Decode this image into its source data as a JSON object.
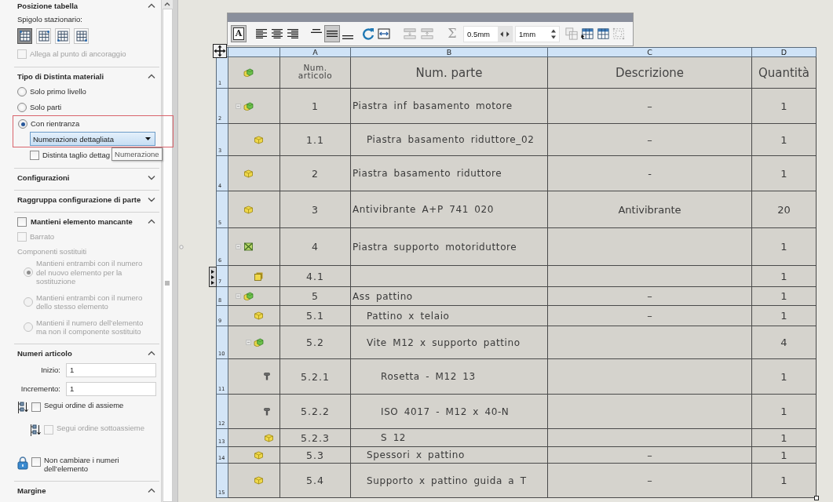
{
  "property_panel": {
    "sections": [
      {
        "title": "Posizione tabella",
        "expanded": true,
        "items": [
          {
            "kind": "label",
            "text": "Spigolo stazionario:",
            "disabled": false
          },
          {
            "kind": "anchor_buttons",
            "options": [
              {
                "selected": true
              },
              {
                "selected": false
              },
              {
                "selected": false
              },
              {
                "selected": false
              }
            ]
          },
          {
            "kind": "checkbox",
            "label": "Allega al punto di ancoraggio",
            "checked": false,
            "disabled": true
          }
        ]
      },
      {
        "title": "Tipo di Distinta materiali",
        "expanded": true,
        "items": [
          {
            "kind": "radio",
            "label": "Solo primo livello",
            "selected": false,
            "disabled": false
          },
          {
            "kind": "radio",
            "label": "Solo parti",
            "selected": false,
            "disabled": false
          },
          {
            "kind": "radio",
            "label": "Con rientranza",
            "selected": true,
            "disabled": false,
            "highlighted": true,
            "dropdown": {
              "value": "Numerazione dettagliata"
            },
            "children": [
              {
                "kind": "checkbox",
                "label": "Distinta taglio dettag",
                "checked": false,
                "disabled": false,
                "tooltip": "Numerazione"
              }
            ]
          }
        ]
      },
      {
        "title": "Configurazioni",
        "expanded": false
      },
      {
        "title": "Raggruppa configurazione di parte",
        "expanded": false
      },
      {
        "title": "Mantieni elemento mancante",
        "expanded": true,
        "checkbox": {
          "checked": false
        },
        "items": [
          {
            "kind": "checkbox",
            "label": "Barrato",
            "checked": false,
            "disabled": true
          },
          {
            "kind": "label",
            "text": "Componenti sostituiti",
            "disabled": true,
            "children": [
              {
                "kind": "radio",
                "label": "Mantieni entrambi con il numero del nuovo elemento per la sostituzione",
                "selected": true,
                "disabled": true
              },
              {
                "kind": "radio",
                "label": "Mantieni entrambi con il numero dello stesso elemento",
                "selected": false,
                "disabled": true
              },
              {
                "kind": "radio",
                "label": "Mantieni il numero dell’elemento ma non il componente sostituito",
                "selected": false,
                "disabled": true
              }
            ]
          }
        ]
      },
      {
        "title": "Numeri articolo",
        "expanded": true,
        "items": [
          {
            "kind": "field",
            "label": "Inizio:",
            "value": "1",
            "disabled": false
          },
          {
            "kind": "field",
            "label": "Incremento:",
            "value": "1",
            "disabled": false
          },
          {
            "kind": "tree_checkbox",
            "label": "Segui ordine di assieme",
            "checked": false,
            "disabled": false,
            "children": [
              {
                "kind": "tree_checkbox",
                "label": "Segui ordine sottoassieme",
                "checked": false,
                "disabled": true
              }
            ]
          },
          {
            "kind": "lock_checkbox",
            "label": "Non cambiare i numeri dell’elemento",
            "checked": false,
            "disabled": false
          }
        ]
      },
      {
        "title": "Margine",
        "expanded": true
      }
    ]
  },
  "format_toolbar": {
    "groups": [
      {
        "tools": [
          {
            "kind": "text-format",
            "glyph": "A",
            "on": true,
            "disabled": false
          }
        ]
      },
      {
        "tools": [
          {
            "kind": "align-left",
            "on": false,
            "disabled": false
          },
          {
            "kind": "align-center",
            "on": false,
            "disabled": false
          },
          {
            "kind": "align-right",
            "on": false,
            "disabled": false
          }
        ]
      },
      {
        "tools": [
          {
            "kind": "align-top",
            "on": false,
            "disabled": false
          },
          {
            "kind": "align-middle",
            "on": true,
            "disabled": false
          },
          {
            "kind": "align-bottom",
            "on": false,
            "disabled": false
          }
        ]
      },
      {
        "tools": [
          {
            "kind": "rotate",
            "on": false,
            "disabled": false
          },
          {
            "kind": "fit-width",
            "on": false,
            "disabled": false
          }
        ]
      },
      {
        "tools": [
          {
            "kind": "insert-below",
            "on": false,
            "disabled": true
          },
          {
            "kind": "insert-above",
            "on": false,
            "disabled": true
          }
        ]
      },
      {
        "tools": [
          {
            "kind": "sum",
            "glyph": "Σ",
            "on": false,
            "disabled": true
          },
          {
            "kind": "spin-horizontal",
            "value": "0.5mm"
          },
          {
            "kind": "spin-vertical",
            "value": "1mm"
          }
        ]
      },
      {
        "tools": [
          {
            "kind": "copy-format",
            "on": false,
            "disabled": true
          },
          {
            "kind": "table-properties",
            "on": false,
            "disabled": false
          },
          {
            "kind": "table-grid",
            "on": false,
            "disabled": false
          },
          {
            "kind": "borders",
            "on": false,
            "disabled": true
          }
        ]
      }
    ]
  },
  "bom_table": {
    "column_letters": [
      "A",
      "B",
      "C",
      "D"
    ],
    "header_row": {
      "row_label": "1",
      "cells": [
        "Num. articolo",
        "Num. parte",
        "Descrizione",
        "Quantità"
      ]
    },
    "rows": [
      {
        "row_label": "2",
        "kind": "assembly",
        "expanded": true,
        "item": "1",
        "part": "Piastra inf basamento motore",
        "description": "–",
        "quantity": "1",
        "children": [
          {
            "row_label": "3",
            "kind": "part",
            "expanded": false,
            "item": "1.1",
            "part": "Piastra basamento riduttore_02",
            "description": "–",
            "quantity": "1"
          }
        ]
      },
      {
        "row_label": "4",
        "kind": "part",
        "expanded": false,
        "item": "2",
        "part": "Piastra basamento riduttore",
        "description": "-",
        "quantity": "1"
      },
      {
        "row_label": "5",
        "kind": "part",
        "expanded": false,
        "item": "3",
        "part": "Antivibrante A+P 741 020",
        "description": "Antivibrante",
        "quantity": "20"
      },
      {
        "row_label": "6",
        "kind": "weldment",
        "expanded": true,
        "item": "4",
        "part": "Piastra supporto motoriduttore",
        "quantity": "1",
        "children": [
          {
            "row_label": "7",
            "kind": "body",
            "expanded": false,
            "item": "4.1",
            "quantity": "1"
          }
        ]
      },
      {
        "row_label": "8",
        "kind": "assembly",
        "expanded": true,
        "item": "5",
        "part": "Ass pattino",
        "description": "–",
        "quantity": "1",
        "children": [
          {
            "row_label": "9",
            "kind": "part",
            "expanded": false,
            "item": "5.1",
            "part": "Pattino x telaio",
            "description": "–",
            "quantity": "1"
          },
          {
            "row_label": "10",
            "kind": "assembly",
            "expanded": true,
            "item": "5.2",
            "part": "Vite M12 x supporto pattino",
            "quantity": "4",
            "children": [
              {
                "row_label": "11",
                "kind": "toolbox",
                "expanded": false,
                "item": "5.2.1",
                "part": "Rosetta - M12 13",
                "quantity": "1"
              },
              {
                "row_label": "12",
                "kind": "toolbox",
                "expanded": false,
                "item": "5.2.2",
                "part": "ISO 4017 - M12 x 40-N",
                "quantity": "1"
              },
              {
                "row_label": "13",
                "kind": "part",
                "expanded": false,
                "item": "5.2.3",
                "part": "S 12",
                "quantity": "1"
              }
            ]
          },
          {
            "row_label": "14",
            "kind": "part",
            "expanded": false,
            "item": "5.3",
            "part": "Spessori x pattino",
            "description": "–",
            "quantity": "1"
          },
          {
            "row_label": "15",
            "kind": "part",
            "expanded": false,
            "item": "5.4",
            "part": "Supporto x pattino guida a T",
            "description": "–",
            "quantity": "1"
          }
        ]
      }
    ]
  }
}
